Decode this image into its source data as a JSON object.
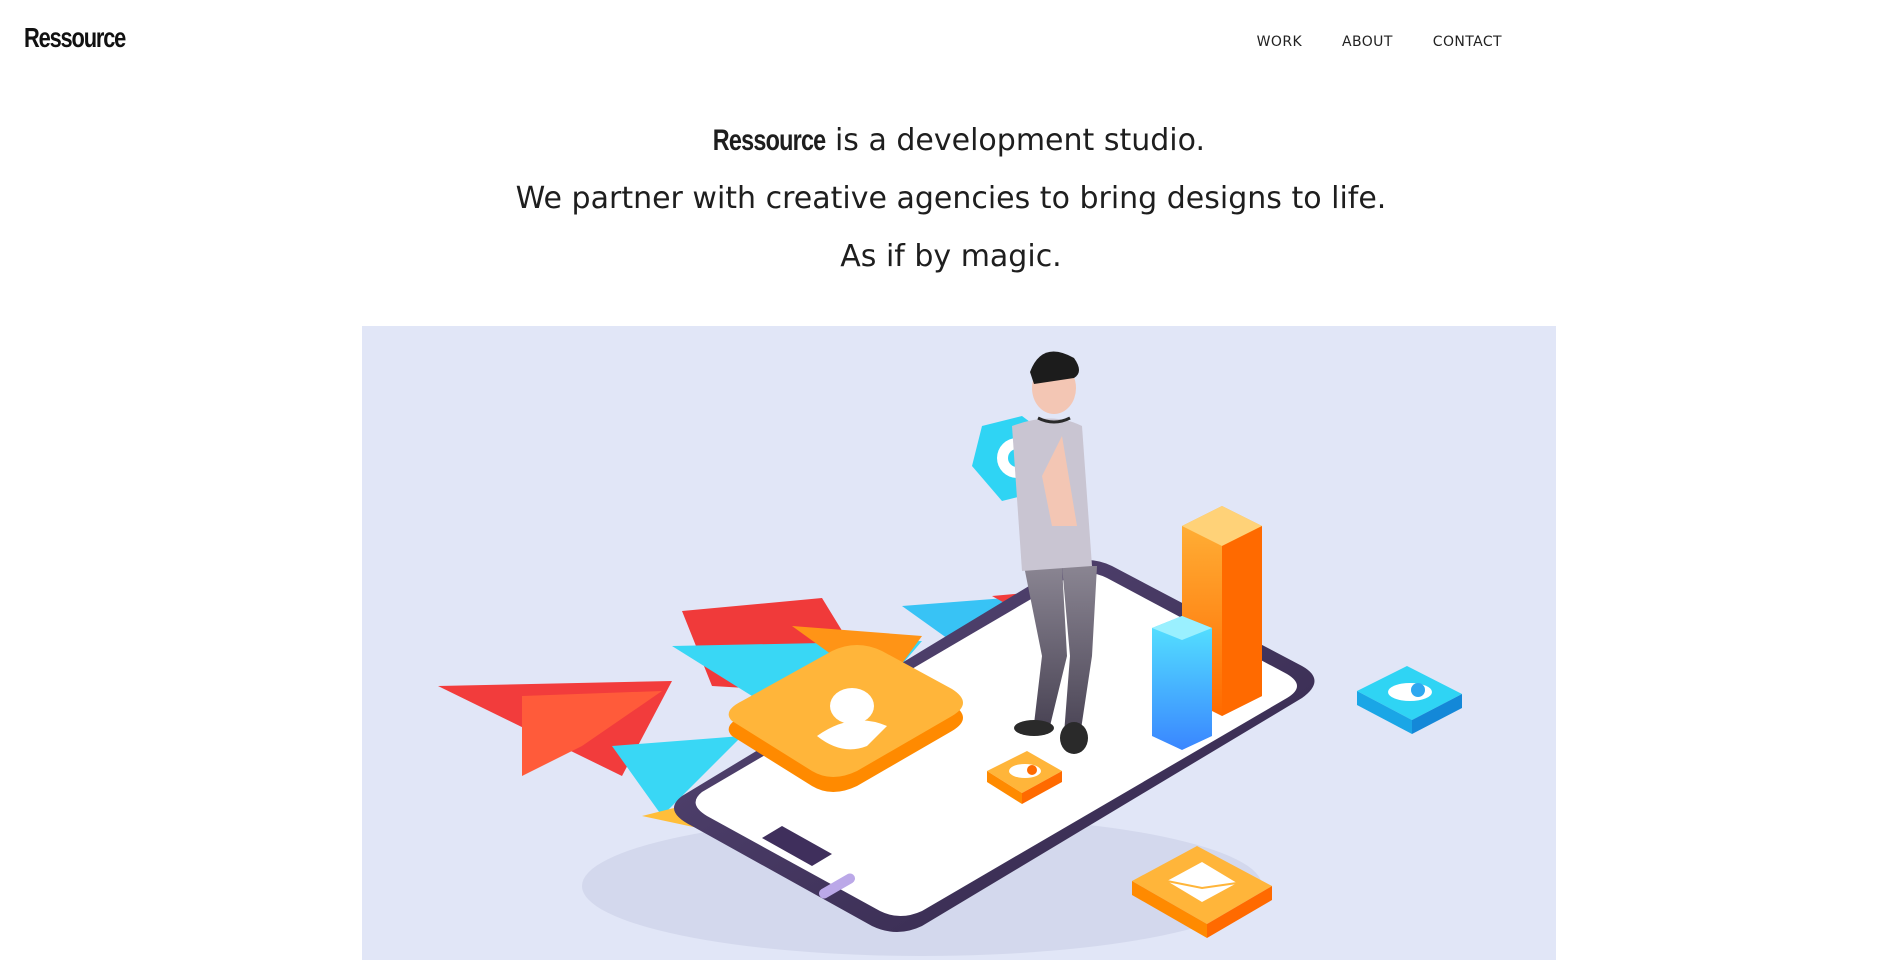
{
  "header": {
    "logo": "Ressource",
    "nav": {
      "work": "WORK",
      "about": "ABOUT",
      "contact": "CONTACT"
    }
  },
  "hero": {
    "brand": "Ressource",
    "line1_rest": "is a development studio.",
    "line2": "We partner with creative agencies to bring designs to life.",
    "line3": "As if by magic."
  },
  "illustration": {
    "background": "#e1e6f7",
    "description_icon": "person-holding-phone-app-icons"
  },
  "colors": {
    "orange": "#ff9d1a",
    "cyan": "#2fd4f4",
    "red": "#f1363b",
    "purple_dark": "#3f2f5c",
    "grey_shirt": "#c9c5d2"
  }
}
